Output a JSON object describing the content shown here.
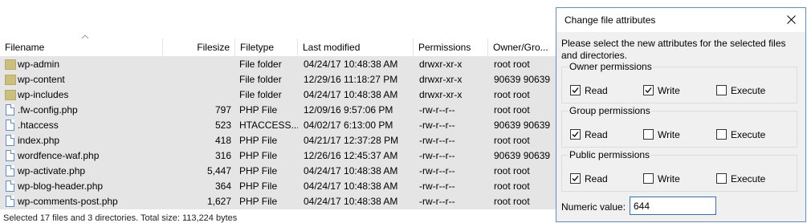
{
  "filelist": {
    "columns": [
      "Filename",
      "Filesize",
      "Filetype",
      "Last modified",
      "Permissions",
      "Owner/Gro..."
    ],
    "rows": [
      {
        "name": "wp-admin",
        "size": "",
        "type": "File folder",
        "modified": "04/24/17 10:48:38 AM",
        "perms": "drwxr-xr-x",
        "owner": "root root",
        "kind": "folder",
        "selected": true
      },
      {
        "name": "wp-content",
        "size": "",
        "type": "File folder",
        "modified": "12/29/16 11:18:27 PM",
        "perms": "drwxr-xr-x",
        "owner": "90639 90639",
        "kind": "folder",
        "selected": true
      },
      {
        "name": "wp-includes",
        "size": "",
        "type": "File folder",
        "modified": "04/24/17 10:48:38 AM",
        "perms": "drwxr-xr-x",
        "owner": "root root",
        "kind": "folder",
        "selected": true
      },
      {
        "name": ".fw-config.php",
        "size": "797",
        "type": "PHP File",
        "modified": "12/09/16 9:57:06 PM",
        "perms": "-rw-r--r--",
        "owner": "root root",
        "kind": "file",
        "selected": true
      },
      {
        "name": ".htaccess",
        "size": "523",
        "type": "HTACCESS...",
        "modified": "04/02/17 6:13:00 PM",
        "perms": "-rw-r--r--",
        "owner": "90639 90639",
        "kind": "file",
        "selected": true
      },
      {
        "name": "index.php",
        "size": "418",
        "type": "PHP File",
        "modified": "04/21/17 12:37:28 PM",
        "perms": "-rw-r--r--",
        "owner": "root root",
        "kind": "file",
        "selected": true
      },
      {
        "name": "wordfence-waf.php",
        "size": "316",
        "type": "PHP File",
        "modified": "12/26/16 12:45:37 AM",
        "perms": "-rw-r--r--",
        "owner": "90639 90639",
        "kind": "file",
        "selected": true
      },
      {
        "name": "wp-activate.php",
        "size": "5,447",
        "type": "PHP File",
        "modified": "04/24/17 10:48:38 AM",
        "perms": "-rw-r--r--",
        "owner": "root root",
        "kind": "file",
        "selected": true
      },
      {
        "name": "wp-blog-header.php",
        "size": "364",
        "type": "PHP File",
        "modified": "04/24/17 10:48:38 AM",
        "perms": "-rw-r--r--",
        "owner": "root root",
        "kind": "file",
        "selected": true
      },
      {
        "name": "wp-comments-post.php",
        "size": "1,627",
        "type": "PHP File",
        "modified": "04/24/17 10:48:38 AM",
        "perms": "-rw-r--r--",
        "owner": "root root",
        "kind": "file",
        "selected": true
      }
    ],
    "status": "Selected 17 files and 3 directories. Total size: 113,224 bytes"
  },
  "dialog": {
    "title": "Change file attributes",
    "prompt": "Please select the new attributes for the selected files and directories.",
    "groups": [
      {
        "label": "Owner permissions",
        "read": true,
        "write": true,
        "execute": false
      },
      {
        "label": "Group permissions",
        "read": true,
        "write": false,
        "execute": false
      },
      {
        "label": "Public permissions",
        "read": true,
        "write": false,
        "execute": false
      }
    ],
    "checkbox_labels": {
      "read": "Read",
      "write": "Write",
      "execute": "Execute"
    },
    "numeric_label": "Numeric value:",
    "numeric_value": "644"
  },
  "colors": {
    "selected_row": "#e5e5e5",
    "dialog_bg": "#f0f0f0",
    "dialog_border": "#5a8fd0",
    "focus_border": "#2f73c9"
  },
  "icons": {
    "folder": "folder-icon",
    "file": "file-icon",
    "close": "close-icon",
    "check": "checkmark-icon",
    "sort": "sort-ascending-icon"
  }
}
